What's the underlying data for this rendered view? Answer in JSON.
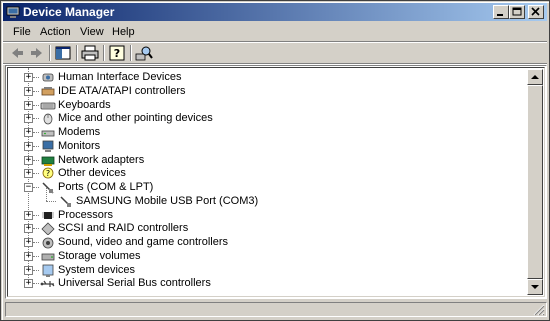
{
  "window": {
    "title": "Device Manager"
  },
  "menubar": [
    {
      "label": "File"
    },
    {
      "label": "Action"
    },
    {
      "label": "View"
    },
    {
      "label": "Help"
    }
  ],
  "tree": {
    "items": [
      {
        "label": "Human Interface Devices",
        "icon": "hid-icon"
      },
      {
        "label": "IDE ATA/ATAPI controllers",
        "icon": "ide-controller-icon"
      },
      {
        "label": "Keyboards",
        "icon": "keyboard-icon"
      },
      {
        "label": "Mice and other pointing devices",
        "icon": "mouse-icon"
      },
      {
        "label": "Modems",
        "icon": "modem-icon"
      },
      {
        "label": "Monitors",
        "icon": "monitor-icon"
      },
      {
        "label": "Network adapters",
        "icon": "network-adapter-icon"
      },
      {
        "label": "Other devices",
        "icon": "other-devices-icon"
      },
      {
        "label": "Ports (COM & LPT)",
        "icon": "port-icon",
        "expanded": true
      },
      {
        "label": "SAMSUNG Mobile USB Port (COM3)",
        "icon": "port-device-icon",
        "child": true
      },
      {
        "label": "Processors",
        "icon": "processor-icon"
      },
      {
        "label": "SCSI and RAID controllers",
        "icon": "scsi-icon"
      },
      {
        "label": "Sound, video and game controllers",
        "icon": "sound-icon"
      },
      {
        "label": "Storage volumes",
        "icon": "storage-icon"
      },
      {
        "label": "System devices",
        "icon": "system-device-icon"
      },
      {
        "label": "Universal Serial Bus controllers",
        "icon": "usb-icon"
      }
    ]
  },
  "colors": {
    "titlebar_start": "#0a246a",
    "titlebar_end": "#a6caf0",
    "face": "#d4d0c8"
  }
}
